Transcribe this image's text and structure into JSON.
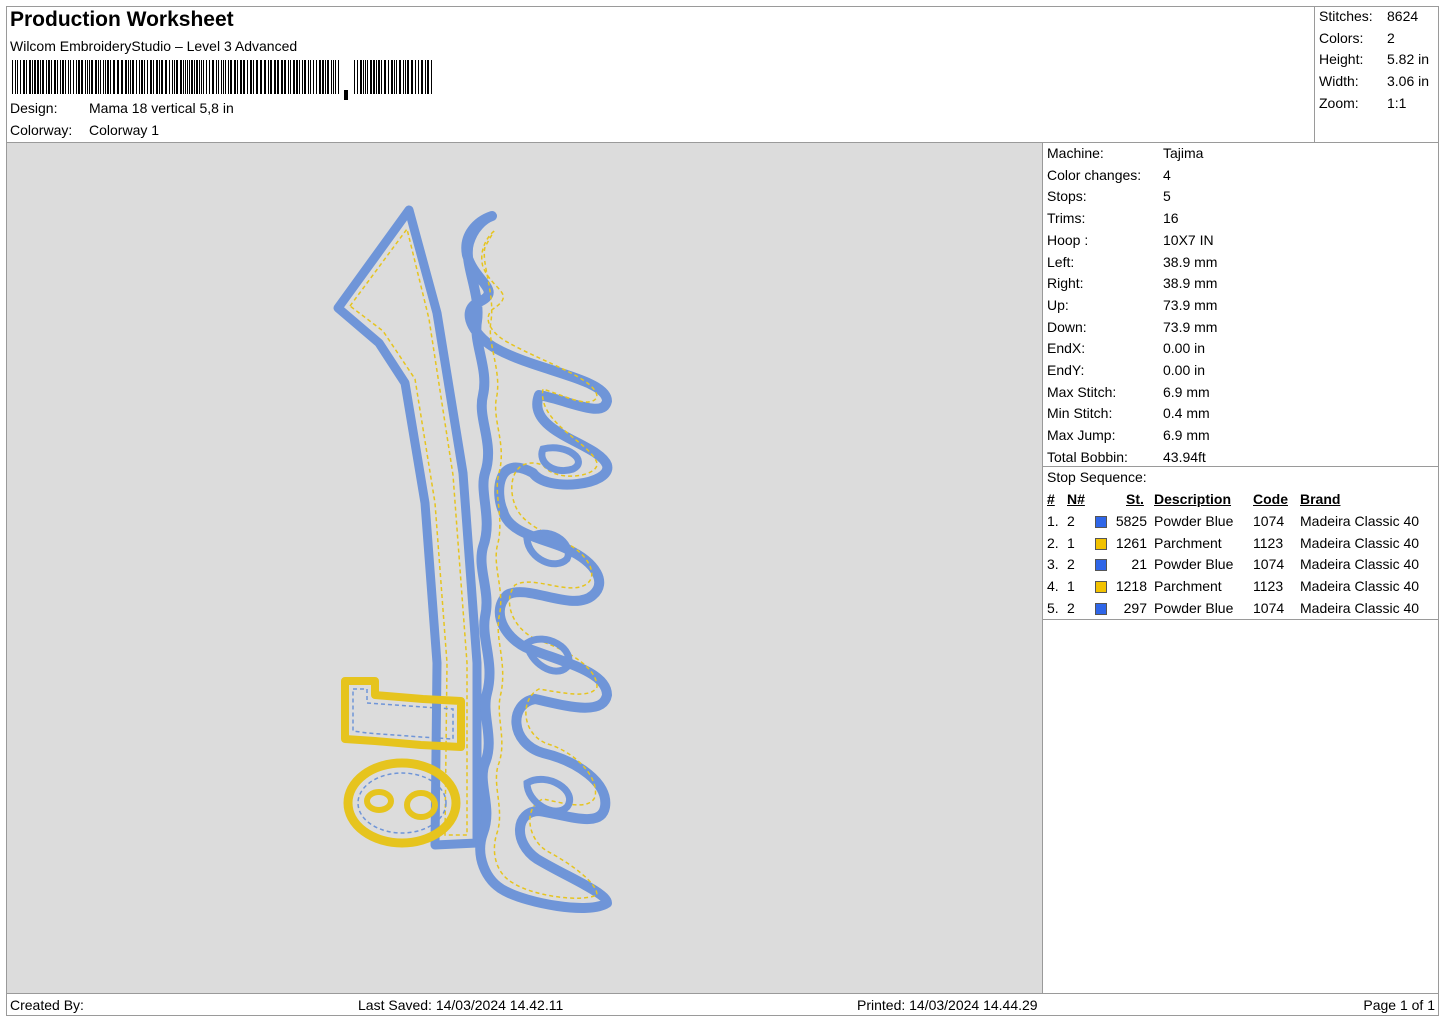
{
  "header": {
    "title": "Production Worksheet",
    "software": "Wilcom EmbroideryStudio – Level 3 Advanced",
    "design_label": "Design:",
    "design_value": "Mama 18 vertical 5,8 in",
    "colorway_label": "Colorway:",
    "colorway_value": "Colorway 1"
  },
  "stats": [
    {
      "label": "Stitches:",
      "value": "8624"
    },
    {
      "label": "Colors:",
      "value": "2"
    },
    {
      "label": "Height:",
      "value": "5.82 in"
    },
    {
      "label": "Width:",
      "value": "3.06 in"
    },
    {
      "label": "Zoom:",
      "value": "1:1"
    }
  ],
  "machine_info": [
    {
      "label": "Machine:",
      "value": "Tajima"
    },
    {
      "label": "Color changes:",
      "value": "4"
    },
    {
      "label": "Stops:",
      "value": "5"
    },
    {
      "label": "Trims:",
      "value": "16"
    },
    {
      "label": "Hoop :",
      "value": "10X7 IN"
    },
    {
      "label": "Left:",
      "value": "38.9 mm"
    },
    {
      "label": "Right:",
      "value": "38.9 mm"
    },
    {
      "label": "Up:",
      "value": "73.9 mm"
    },
    {
      "label": "Down:",
      "value": "73.9 mm"
    },
    {
      "label": "EndX:",
      "value": "0.00 in"
    },
    {
      "label": "EndY:",
      "value": "0.00 in"
    },
    {
      "label": "Max Stitch:",
      "value": "6.9 mm"
    },
    {
      "label": "Min Stitch:",
      "value": "0.4 mm"
    },
    {
      "label": "Max Jump:",
      "value": "6.9 mm"
    },
    {
      "label": "Total Bobbin:",
      "value": "43.94ft"
    }
  ],
  "stop_sequence": {
    "title": "Stop Sequence:",
    "headers": {
      "num": "#",
      "needle": "N#",
      "stitches": "St.",
      "description": "Description",
      "code": "Code",
      "brand": "Brand"
    },
    "rows": [
      {
        "num": "1.",
        "needle": "2",
        "color": "#2f66e8",
        "stitches": "5825",
        "description": "Powder Blue",
        "code": "1074",
        "brand": "Madeira Classic 40"
      },
      {
        "num": "2.",
        "needle": "1",
        "color": "#f2c200",
        "stitches": "1261",
        "description": "Parchment",
        "code": "1123",
        "brand": "Madeira Classic 40"
      },
      {
        "num": "3.",
        "needle": "2",
        "color": "#2f66e8",
        "stitches": "21",
        "description": "Powder Blue",
        "code": "1074",
        "brand": "Madeira Classic 40"
      },
      {
        "num": "4.",
        "needle": "1",
        "color": "#f2c200",
        "stitches": "1218",
        "description": "Parchment",
        "code": "1123",
        "brand": "Madeira Classic 40"
      },
      {
        "num": "5.",
        "needle": "2",
        "color": "#2f66e8",
        "stitches": "297",
        "description": "Powder Blue",
        "code": "1074",
        "brand": "Madeira Classic 40"
      }
    ]
  },
  "design": {
    "word": "Mama",
    "number": "18",
    "outline_color": "#6f95d8",
    "accent_color": "#e6c41e"
  },
  "footer": {
    "created_by": "Created By:",
    "last_saved": "Last Saved: 14/03/2024 14.42.11",
    "printed": "Printed: 14/03/2024 14.44.29",
    "page": "Page 1 of 1"
  }
}
